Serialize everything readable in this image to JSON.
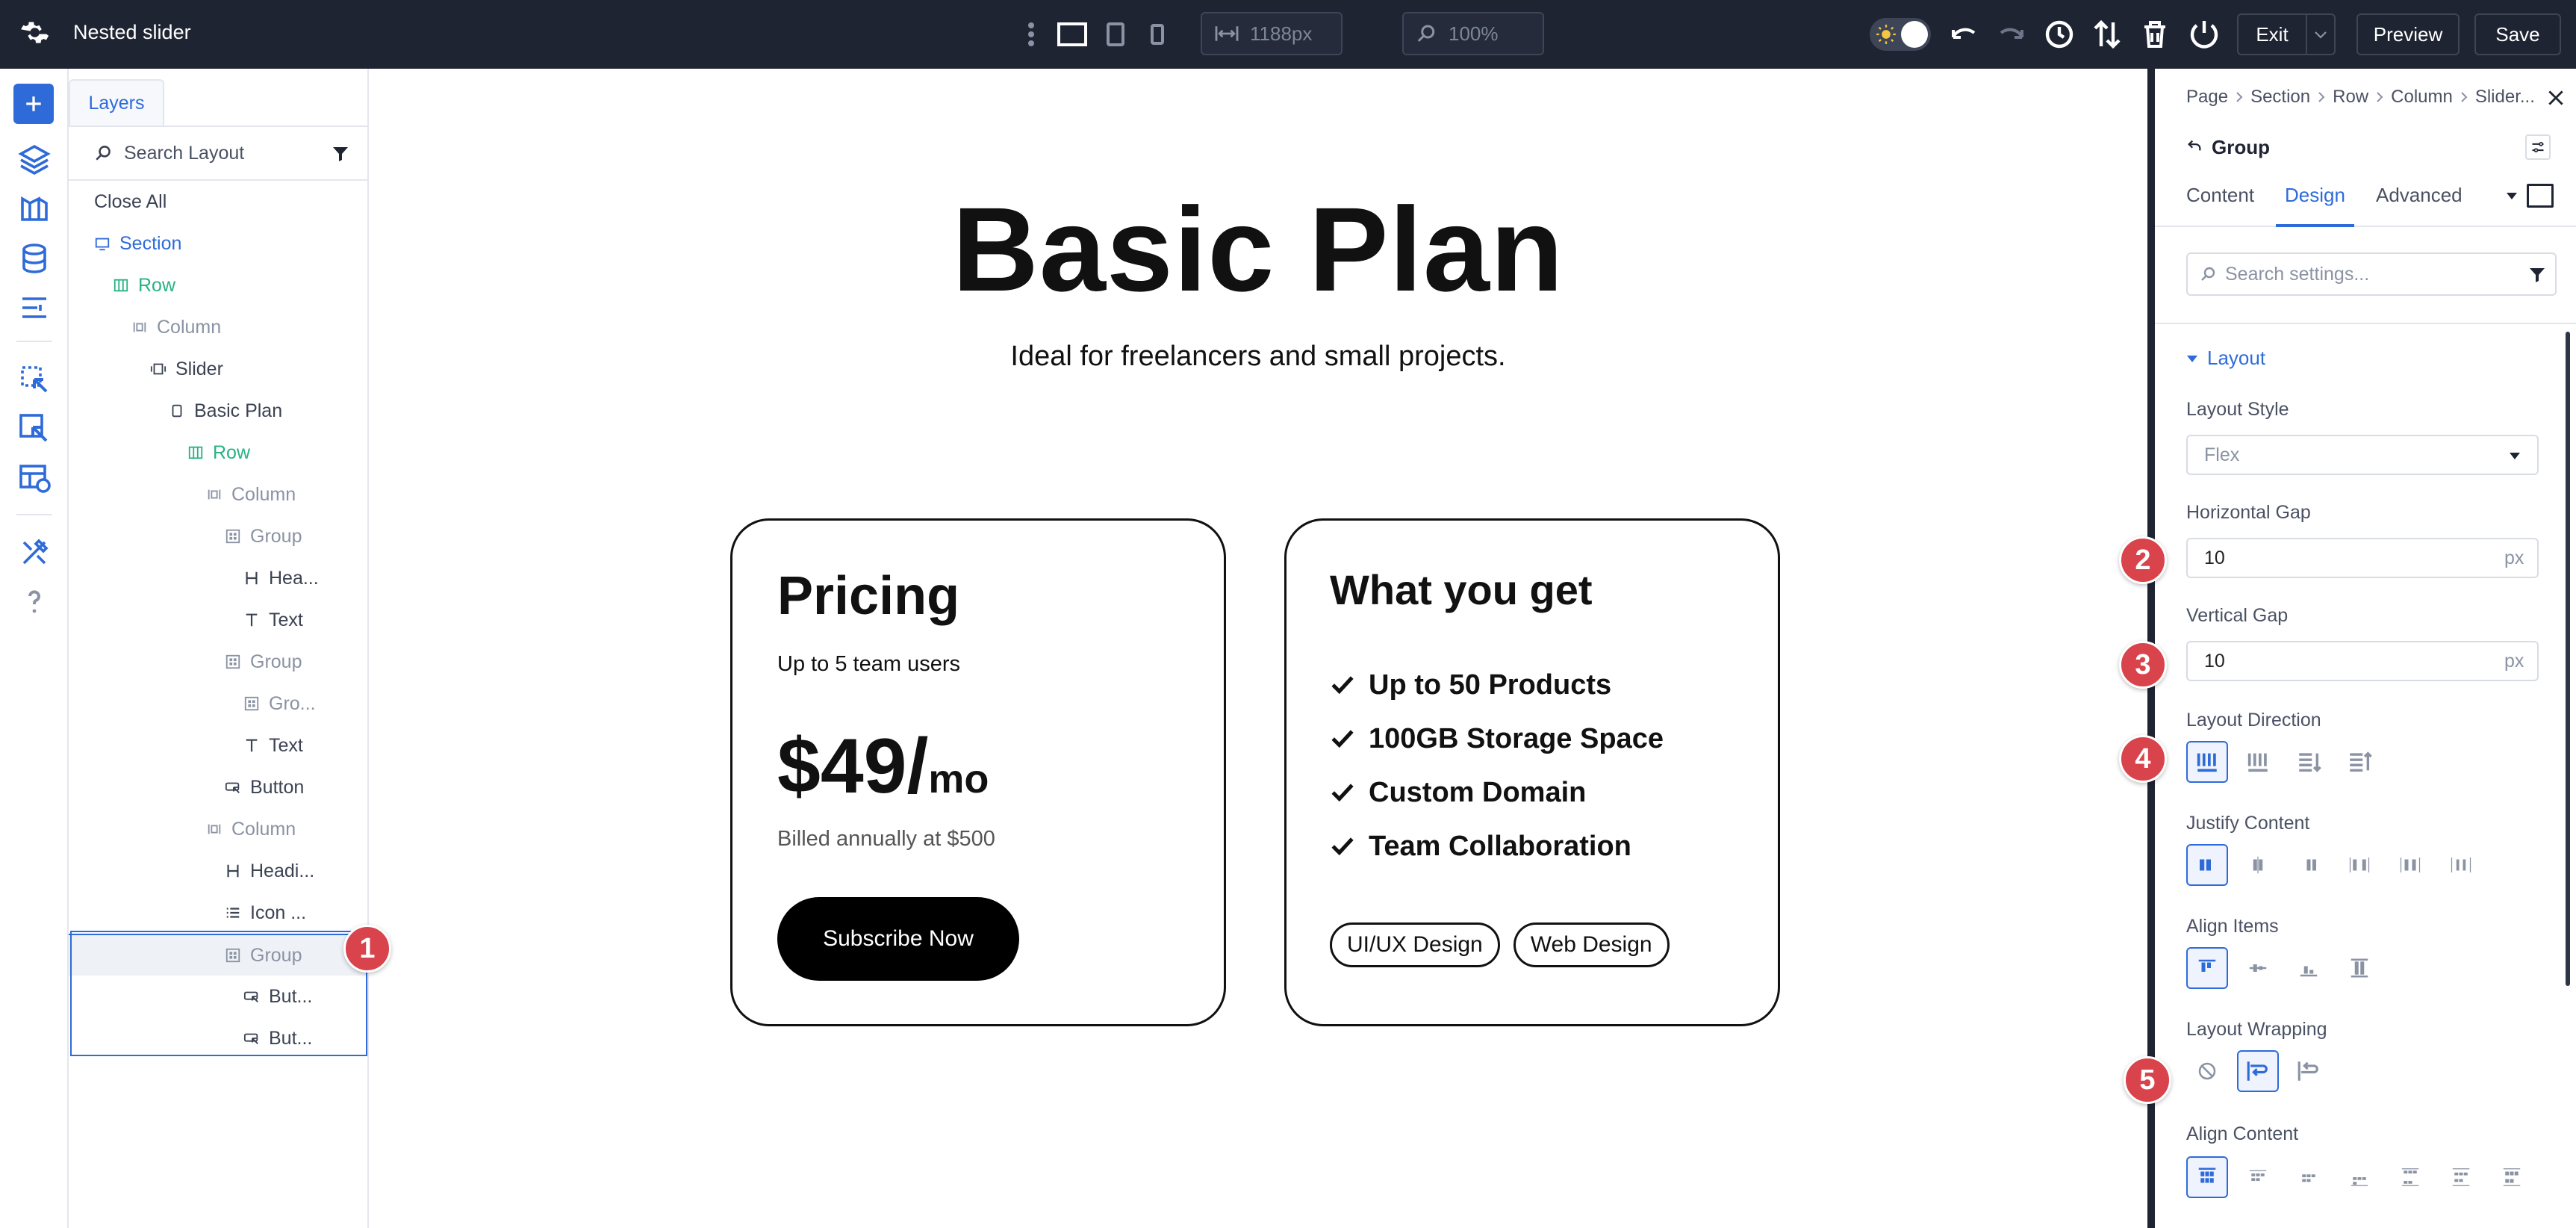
{
  "app": {
    "title": "Nested slider"
  },
  "topbar": {
    "width_value": "1188px",
    "zoom_value": "100%",
    "exit_label": "Exit",
    "preview_label": "Preview",
    "save_label": "Save"
  },
  "layers": {
    "tab_label": "Layers",
    "search_placeholder": "Search Layout",
    "close_all": "Close All",
    "items": [
      {
        "label": "Section",
        "icon": "section-icon",
        "depth": 1,
        "color": "#2e6bd9"
      },
      {
        "label": "Row",
        "icon": "row-icon",
        "depth": 2,
        "color": "#27b283"
      },
      {
        "label": "Column",
        "icon": "column-icon",
        "depth": 3,
        "color": "#8a92a3"
      },
      {
        "label": "Slider",
        "icon": "slider-icon",
        "depth": 4,
        "color": "#3b4252"
      },
      {
        "label": "Basic Plan",
        "icon": "slide-icon",
        "depth": 5,
        "color": "#3b4252"
      },
      {
        "label": "Row",
        "icon": "row-icon",
        "depth": 6,
        "color": "#27b283"
      },
      {
        "label": "Column",
        "icon": "column-icon",
        "depth": 7,
        "color": "#8a92a3"
      },
      {
        "label": "Group",
        "icon": "group-icon",
        "depth": 8,
        "color": "#8a92a3"
      },
      {
        "label": "Hea...",
        "icon": "heading-icon",
        "depth": 9,
        "color": "#3b4252"
      },
      {
        "label": "Text",
        "icon": "text-icon",
        "depth": 9,
        "color": "#3b4252"
      },
      {
        "label": "Group",
        "icon": "group-icon",
        "depth": 8,
        "color": "#8a92a3"
      },
      {
        "label": "Gro...",
        "icon": "group-icon",
        "depth": 9,
        "color": "#8a92a3"
      },
      {
        "label": "Text",
        "icon": "text-icon",
        "depth": 9,
        "color": "#3b4252"
      },
      {
        "label": "Button",
        "icon": "button-icon",
        "depth": 8,
        "color": "#3b4252"
      },
      {
        "label": "Column",
        "icon": "column-icon",
        "depth": 7,
        "color": "#8a92a3"
      },
      {
        "label": "Headi...",
        "icon": "heading-icon",
        "depth": 8,
        "color": "#3b4252"
      },
      {
        "label": "Icon ...",
        "icon": "icon-list-icon",
        "depth": 8,
        "color": "#3b4252"
      },
      {
        "label": "Group",
        "icon": "group-icon",
        "depth": 8,
        "color": "#8a92a3",
        "selected": true
      },
      {
        "label": "But...",
        "icon": "button-icon",
        "depth": 9,
        "color": "#3b4252"
      },
      {
        "label": "But...",
        "icon": "button-icon",
        "depth": 9,
        "color": "#3b4252"
      }
    ]
  },
  "canvas": {
    "heading": "Basic Plan",
    "subheading": "Ideal for freelancers and small projects.",
    "pricing_card": {
      "title": "Pricing",
      "users": "Up to 5 team users",
      "price": "$49/",
      "period": "mo",
      "billed": "Billed annually at $500",
      "cta": "Subscribe Now"
    },
    "features_card": {
      "title": "What you get",
      "features": [
        "Up to 50 Products",
        "100GB Storage Space",
        "Custom Domain",
        "Team Collaboration"
      ],
      "tags": [
        "UI/UX Design",
        "Web Design"
      ]
    }
  },
  "settings": {
    "breadcrumb": [
      "Page",
      "Section",
      "Row",
      "Column",
      "Slider..."
    ],
    "element_title": "Group",
    "tabs": [
      "Content",
      "Design",
      "Advanced"
    ],
    "active_tab": "Design",
    "search_placeholder": "Search settings...",
    "section_title": "Layout",
    "layout_style_label": "Layout Style",
    "layout_style_value": "Flex",
    "horizontal_gap_label": "Horizontal Gap",
    "horizontal_gap_value": "10",
    "vertical_gap_label": "Vertical Gap",
    "vertical_gap_value": "10",
    "unit": "px",
    "layout_direction_label": "Layout Direction",
    "justify_content_label": "Justify Content",
    "align_items_label": "Align Items",
    "layout_wrapping_label": "Layout Wrapping",
    "align_content_label": "Align Content"
  },
  "badges": [
    "1",
    "2",
    "3",
    "4",
    "5"
  ],
  "colors": {
    "accent": "#2e6bd9",
    "topbar": "#1e2432",
    "badge": "#d9434b",
    "green": "#27b283"
  }
}
